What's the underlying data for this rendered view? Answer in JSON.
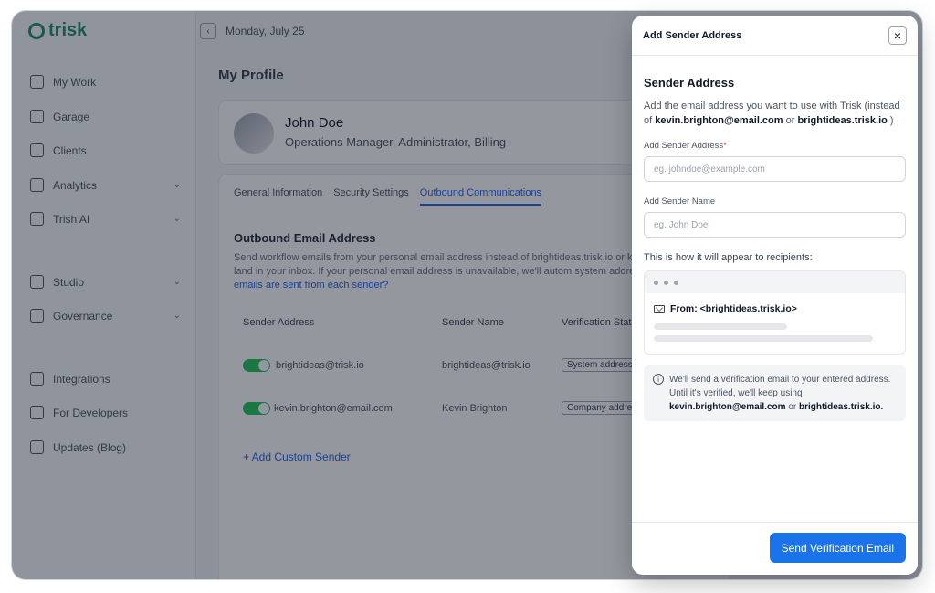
{
  "app": {
    "logo": "trisk",
    "date": "Monday, July 25"
  },
  "sidebar": {
    "items": [
      {
        "label": "My Work",
        "icon": "list-icon"
      },
      {
        "label": "Garage",
        "icon": "garage-icon"
      },
      {
        "label": "Clients",
        "icon": "users-icon"
      },
      {
        "label": "Analytics",
        "icon": "chart-icon"
      },
      {
        "label": "Trish AI",
        "icon": "ai-icon"
      },
      {
        "label": "Studio",
        "icon": "pen-icon"
      },
      {
        "label": "Governance",
        "icon": "bank-icon"
      },
      {
        "label": "Integrations",
        "icon": "puzzle-icon"
      },
      {
        "label": "For Developers",
        "icon": "code-icon"
      },
      {
        "label": "Updates (Blog)",
        "icon": "upload-icon"
      }
    ]
  },
  "main": {
    "page_title": "My Profile",
    "profile": {
      "name": "John Doe",
      "role": "Operations Manager, Administrator, Billing"
    },
    "tabs": [
      "General Information",
      "Security Settings",
      "Outbound Communications"
    ],
    "section_title": "Outbound Email Address",
    "section_desc": "Send workflow emails from your personal email address instead of brightideas.trisk.io or k The replies will land in your inbox. If your personal email address is unavailable, we'll autom system address.",
    "section_link": "Which emails are sent from each sender?",
    "table": {
      "headers": [
        "Sender Address",
        "Sender Name",
        "Verification Statu"
      ],
      "rows": [
        {
          "address": "brightideas@trisk.io",
          "name": "brightideas@trisk.io",
          "status": "System address"
        },
        {
          "address": "kevin.brighton@email.com",
          "name": "Kevin Brighton",
          "status": "Company addres"
        }
      ]
    },
    "add_sender": "+ Add Custom Sender"
  },
  "modal": {
    "header_title": "Add Sender Address",
    "title": "Sender Address",
    "desc_prefix": "Add the email address you want to use with Trisk (instead of ",
    "desc_email": "kevin.brighton@email.com",
    "desc_or": " or ",
    "desc_domain": "brightideas.trisk.io",
    "desc_suffix": " )",
    "address_label": "Add Sender Address",
    "address_required": "*",
    "address_placeholder": "eg. johndoe@example.com",
    "name_label": "Add Sender Name",
    "name_placeholder": "eg. John Doe",
    "preview_label": "This is how it will appear to recipients:",
    "preview_from": "From: <brightideas.trisk.io>",
    "info_text": "We'll send a verification email to your entered address. Until it's verified, we'll keep using ",
    "info_email": "kevin.brighton@email.com",
    "info_or": " or ",
    "info_domain": "brightideas.trisk.io.",
    "send_button": "Send Verification Email"
  },
  "colors": {
    "accent": "#1a73e8",
    "brand": "#1f8a70",
    "toggle_on": "#22c55e",
    "required": "#dc2626"
  }
}
